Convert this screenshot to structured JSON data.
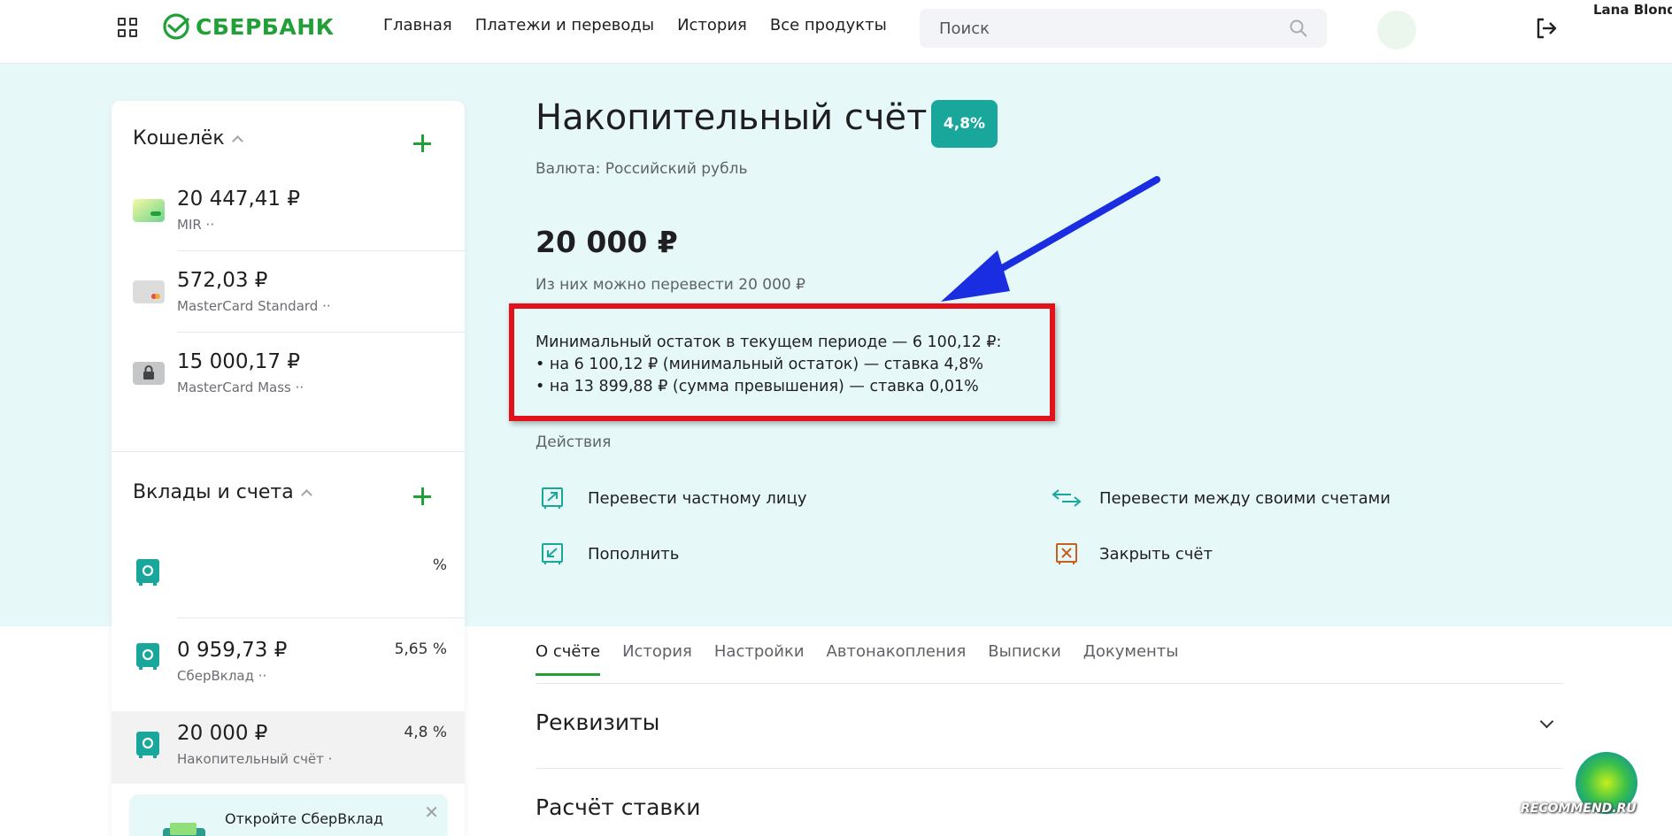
{
  "header": {
    "brand": "СБЕРБАНК",
    "nav": [
      "Главная",
      "Платежи и переводы",
      "История",
      "Все продукты"
    ],
    "search_placeholder": "Поиск",
    "user_name": "Lana Blond"
  },
  "sidebar": {
    "wallet_title": "Кошелёк",
    "cards": [
      {
        "amount": "20 447,41 ₽",
        "label": "MIR ··"
      },
      {
        "amount": "572,03 ₽",
        "label": "MasterCard Standard ··"
      },
      {
        "amount": "15 000,17 ₽",
        "label": "MasterCard Mass ··"
      }
    ],
    "deposits_title": "Вклады и счета",
    "deposits": [
      {
        "amount": "",
        "label": "",
        "rate": "%"
      },
      {
        "amount": "0 959,73 ₽",
        "label": "СберВклад ··",
        "rate": "5,65 %"
      },
      {
        "amount": "20 000 ₽",
        "label": "Накопительный счёт ·",
        "rate": "4,8 %"
      }
    ],
    "promo_text": "Откройте СберВклад"
  },
  "account": {
    "title": "Накопительный счёт",
    "rate_badge": "4,8%",
    "currency": "Валюта: Российский рубль",
    "balance": "20 000 ₽",
    "transferable": "Из них можно перевести 20 000 ₽",
    "min_balance_lines": [
      "Минимальный остаток в текущем периоде — 6 100,12 ₽:",
      "• на 6 100,12 ₽ (минимальный остаток) — ставка 4,8%",
      "• на 13 899,88 ₽ (сумма превышения) — ставка 0,01%"
    ]
  },
  "actions": {
    "label": "Действия",
    "transfer_person": "Перевести частному лицу",
    "transfer_own": "Перевести между своими счетами",
    "top_up": "Пополнить",
    "close": "Закрыть счёт"
  },
  "tabs": [
    "О счёте",
    "История",
    "Настройки",
    "Автонакопления",
    "Выписки",
    "Документы"
  ],
  "sections": {
    "requisites": "Реквизиты",
    "rate_calc": "Расчёт ставки"
  },
  "watermark": "RECOMMEND.RU",
  "colors": {
    "brand_green": "#21a038",
    "teal": "#19a79c",
    "hero_bg": "#e7f8f8",
    "highlight_red": "#e2111a",
    "arrow_blue": "#1a2de0"
  }
}
